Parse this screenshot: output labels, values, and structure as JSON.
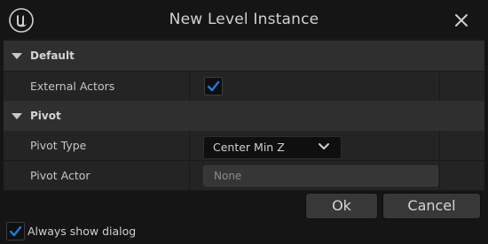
{
  "window": {
    "title": "New Level Instance"
  },
  "icons": {
    "logo": "unreal-logo-icon",
    "close": "close-icon",
    "expand": "chevron-down-icon",
    "check": "checkmark-icon"
  },
  "colors": {
    "accent": "#1e7ae6",
    "background": "#151515",
    "category": "#2f2f2f",
    "row": "#242424"
  },
  "categories": [
    {
      "label": "Default",
      "expanded": true
    },
    {
      "label": "Pivot",
      "expanded": true
    }
  ],
  "properties": {
    "external_actors": {
      "label": "External Actors",
      "checked": true
    },
    "pivot_type": {
      "label": "Pivot Type",
      "value": "Center Min Z"
    },
    "pivot_actor": {
      "label": "Pivot Actor",
      "value": "None"
    }
  },
  "buttons": {
    "ok": "Ok",
    "cancel": "Cancel"
  },
  "always_show_dialog": {
    "label": "Always show dialog",
    "checked": true
  }
}
